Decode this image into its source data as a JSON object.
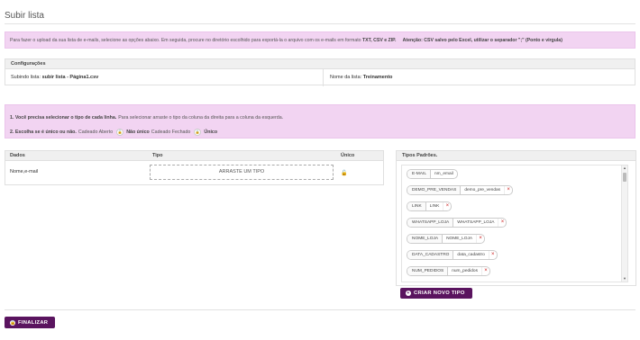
{
  "page": {
    "title": "Subir lista"
  },
  "info": {
    "text": "Para fazer o upload da sua lista de e-mails, selecione as opções abaixo. Em seguida, procure no diretório escolhido para exportá-la o arquivo com os e-mails em formato",
    "formats": "TXT, CSV e ZIP.",
    "warning": "Atenção: CSV salvo pelo Excel, utilizar o separador \";\" (Ponto e virgula)"
  },
  "config": {
    "header": "Configurações",
    "subindo_label": "Subindo lista:",
    "subindo_value": "subir lista - Página1.csv",
    "nome_label": "Nome da lista:",
    "nome_value": "Treinamento"
  },
  "steps": {
    "step1_bold": "1. Você precisa selecionar o tipo de cada linha.",
    "step1_text": "Para selecionar arraste o tipo da coluna da direita para a coluna da esquerda.",
    "step2_bold": "2. Escolha se é único ou não.",
    "step2_open": "Cadeado Aberto",
    "step2_not_unique": "Não único",
    "step2_closed": "Cadeado Fechado",
    "step2_unique": "Único"
  },
  "data_table": {
    "headers": {
      "dados": "Dados",
      "tipo": "Tipo",
      "unico": "Único"
    },
    "rows": [
      {
        "dados": "Nome,e-mail",
        "tipo_placeholder": "ARRASTE UM TIPO"
      }
    ]
  },
  "types_panel": {
    "header": "Tipos Padrões.",
    "items": [
      {
        "key": "E-MAIL",
        "value": "nm_email",
        "removable": false
      },
      {
        "key": "DEMO_PRE_VENDAS",
        "value": "demo_pre_vendas",
        "removable": true
      },
      {
        "key": "LINK",
        "value": "LINK",
        "removable": true
      },
      {
        "key": "WHATSAPP_LOJA",
        "value": "WHATSAPP_LOJA",
        "removable": true
      },
      {
        "key": "NOME_LOJA",
        "value": "NOME_LOJA",
        "removable": true
      },
      {
        "key": "DATA_CADASTRO",
        "value": "data_cadastro",
        "removable": true
      },
      {
        "key": "NUM_PEDIDOS",
        "value": "num_pedidos",
        "removable": true
      }
    ],
    "remove_icon": "×",
    "create_button": "CRIAR NOVO TIPO",
    "create_icon": "+"
  },
  "footer": {
    "finalize_button": "FINALIZAR",
    "finalize_icon": "lock-icon"
  },
  "colors": {
    "accent": "#5a145f",
    "info_bg": "#f2d4f2",
    "remove": "#cc1f1f"
  }
}
